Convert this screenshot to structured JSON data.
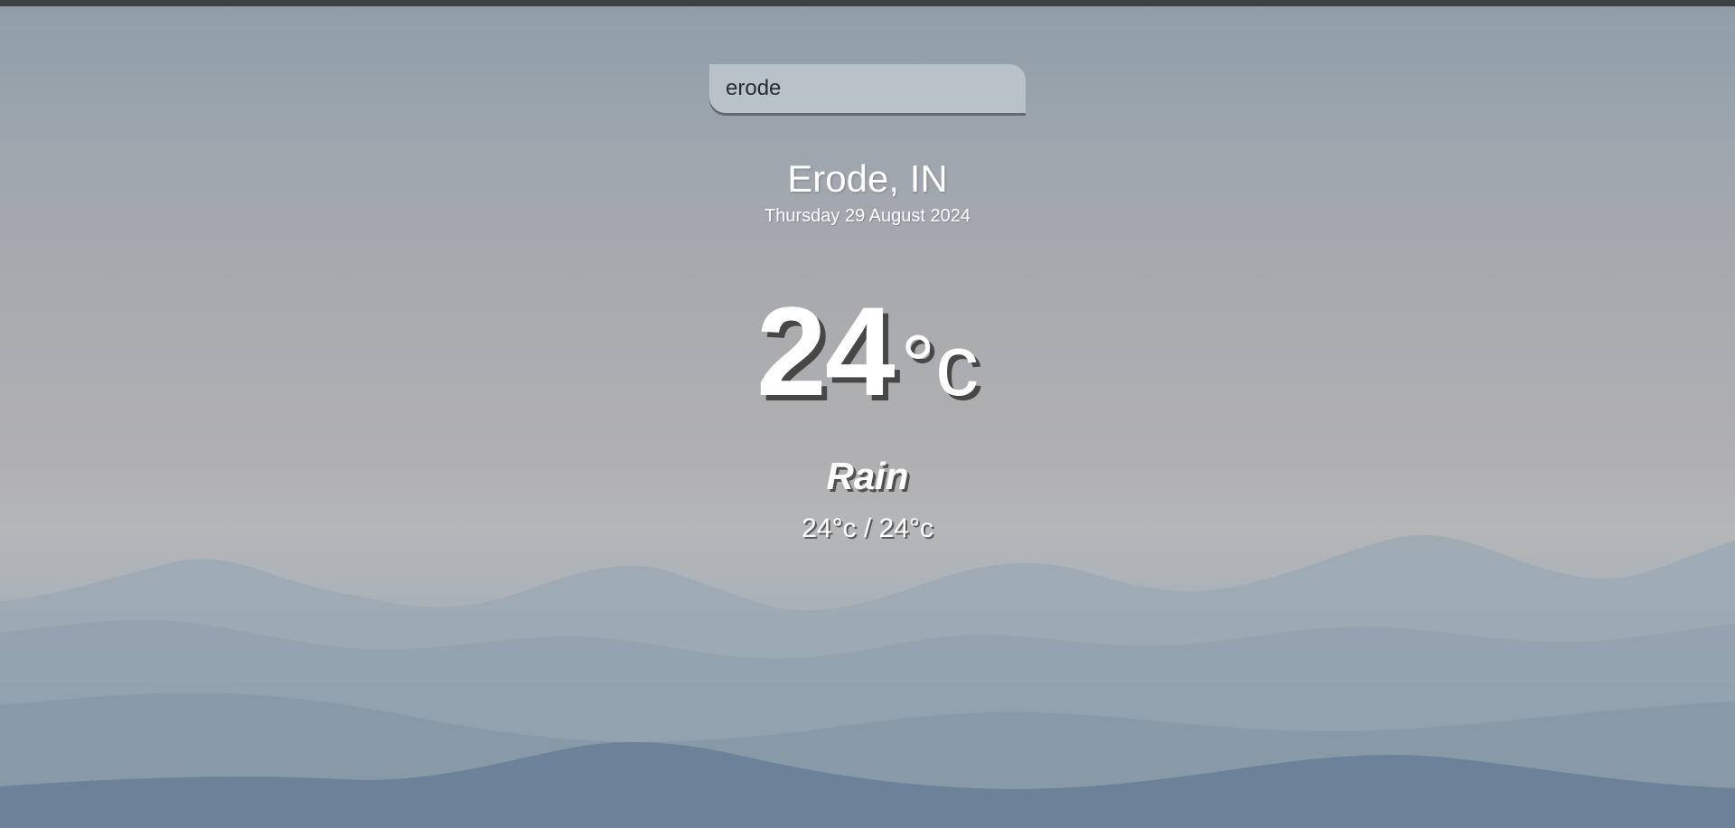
{
  "search": {
    "value": "erode"
  },
  "weather": {
    "location": "Erode, IN",
    "date": "Thursday 29 August 2024",
    "temperature": "24",
    "unit": "°c",
    "condition": "Rain",
    "hi_low": "24°c / 24°c"
  },
  "colors": {
    "text": "#ffffff",
    "text_shadow": "#474747",
    "top_bar": "#3d3f41"
  }
}
